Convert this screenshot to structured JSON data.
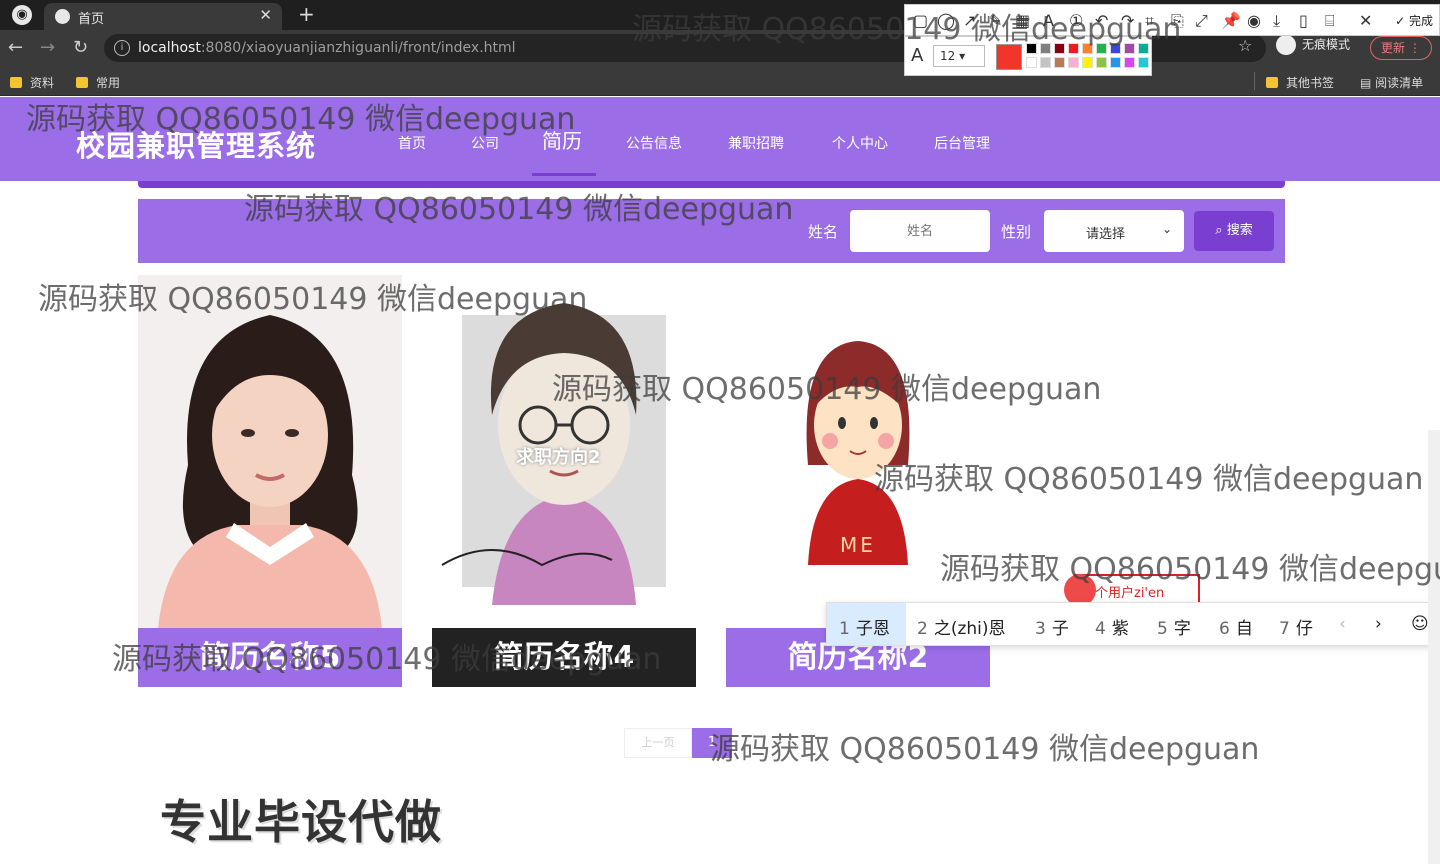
{
  "browser": {
    "tab_title": "首页",
    "url_host": "localhost",
    "url_rest": ":8080/xiaoyuanjianzhiguanli/front/index.html",
    "incognito_label": "无痕模式",
    "update_label": "更新",
    "bookmarks": [
      "资料",
      "常用"
    ],
    "other_bookmarks": "其他书签",
    "reading_list": "阅读清单"
  },
  "screenshot_tool": {
    "done_label": "完成",
    "font_size": "12",
    "current_color": "#f2352b"
  },
  "site": {
    "title": "校园兼职管理系统",
    "nav": [
      "首页",
      "公司",
      "简历",
      "公告信息",
      "兼职招聘",
      "个人中心",
      "后台管理"
    ],
    "active_nav": "简历"
  },
  "search": {
    "name_label": "姓名",
    "name_placeholder": "姓名",
    "gender_label": "性别",
    "gender_value": "请选择",
    "button_label": "搜索"
  },
  "cards": [
    {
      "name": "简历名称5"
    },
    {
      "name": "简历名称4",
      "overlay_text": "求职方向2"
    },
    {
      "name": "简历名称2",
      "shirt_text": "ME"
    }
  ],
  "ime": {
    "composition": "每个用户zi'en",
    "candidates": [
      {
        "n": "1",
        "text": "子恩"
      },
      {
        "n": "2",
        "text": "之(zhi)恩"
      },
      {
        "n": "3",
        "text": "子"
      },
      {
        "n": "4",
        "text": "紫"
      },
      {
        "n": "5",
        "text": "字"
      },
      {
        "n": "6",
        "text": "自"
      },
      {
        "n": "7",
        "text": "仔"
      }
    ]
  },
  "pagination": {
    "prev_label": "上一页",
    "current_page": "1"
  },
  "footer_ad": "专业毕设代做",
  "watermark": "源码获取 QQ86050149 微信deepguan"
}
